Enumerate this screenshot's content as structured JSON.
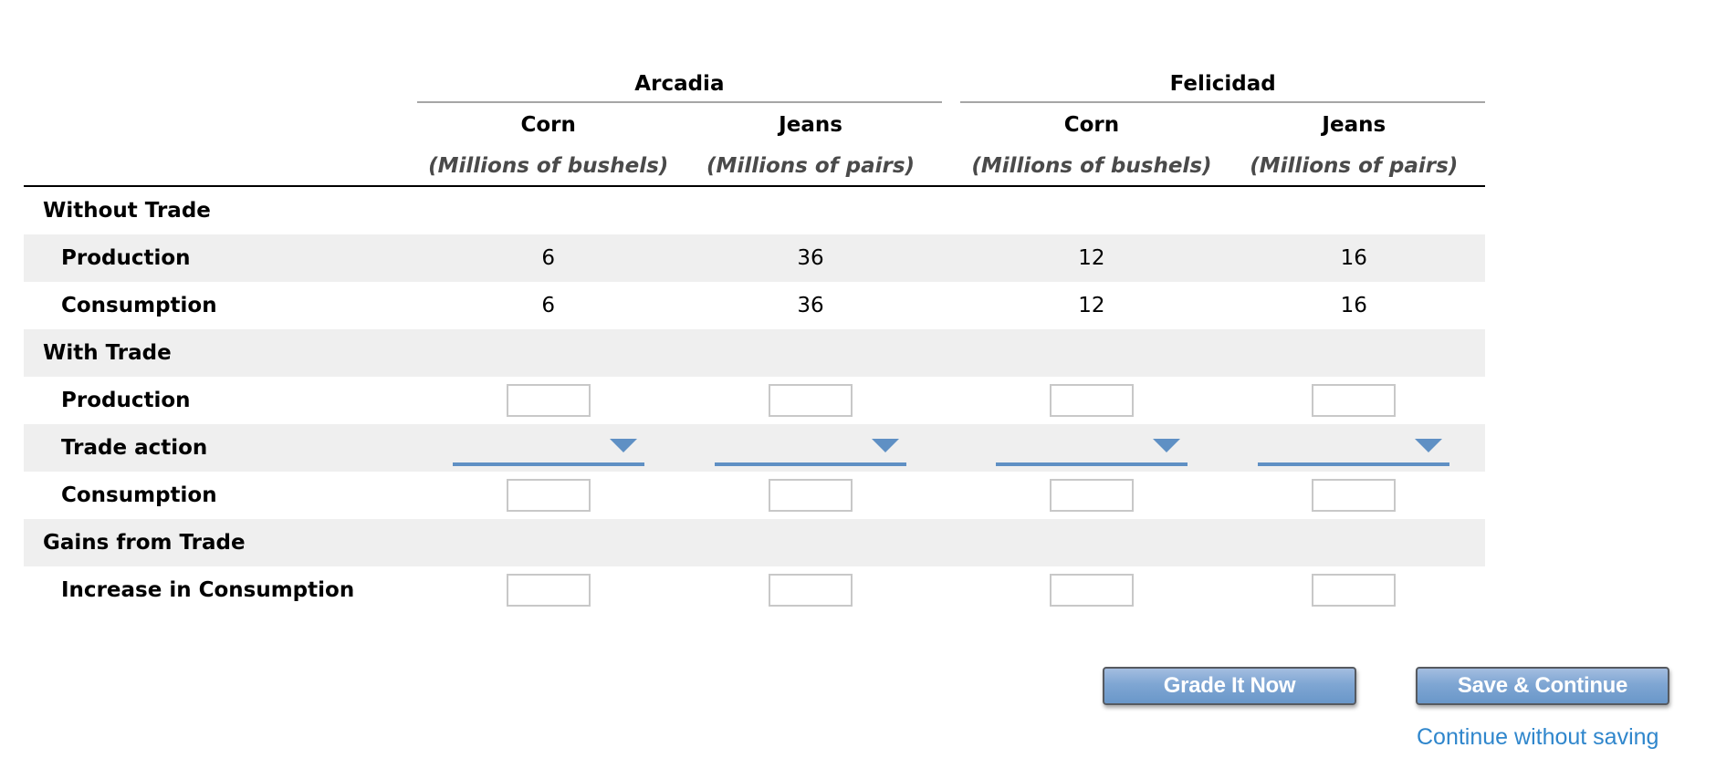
{
  "table": {
    "countries": [
      {
        "name": "Arcadia",
        "goods": [
          {
            "good": "Corn",
            "unit": "(Millions of bushels)"
          },
          {
            "good": "Jeans",
            "unit": "(Millions of pairs)"
          }
        ]
      },
      {
        "name": "Felicidad",
        "goods": [
          {
            "good": "Corn",
            "unit": "(Millions of bushels)"
          },
          {
            "good": "Jeans",
            "unit": "(Millions of pairs)"
          }
        ]
      }
    ],
    "sections": {
      "without_trade": {
        "label": "Without Trade",
        "production": {
          "label": "Production",
          "values": [
            "6",
            "36",
            "12",
            "16"
          ]
        },
        "consumption": {
          "label": "Consumption",
          "values": [
            "6",
            "36",
            "12",
            "16"
          ]
        }
      },
      "with_trade": {
        "label": "With Trade",
        "production": {
          "label": "Production",
          "values": [
            "",
            "",
            "",
            ""
          ]
        },
        "trade_action": {
          "label": "Trade action",
          "selected": [
            "",
            "",
            "",
            ""
          ]
        },
        "consumption": {
          "label": "Consumption",
          "values": [
            "",
            "",
            "",
            ""
          ]
        }
      },
      "gains_from_trade": {
        "label": "Gains from Trade",
        "increase_in_consumption": {
          "label": "Increase in Consumption",
          "values": [
            "",
            "",
            "",
            ""
          ]
        }
      }
    }
  },
  "actions": {
    "grade_label": "Grade It Now",
    "save_label": "Save & Continue",
    "continue_link": "Continue without saving"
  },
  "colors": {
    "accent": "#5f90c4",
    "link": "#2f86cc",
    "row_shade": "#efefef"
  }
}
